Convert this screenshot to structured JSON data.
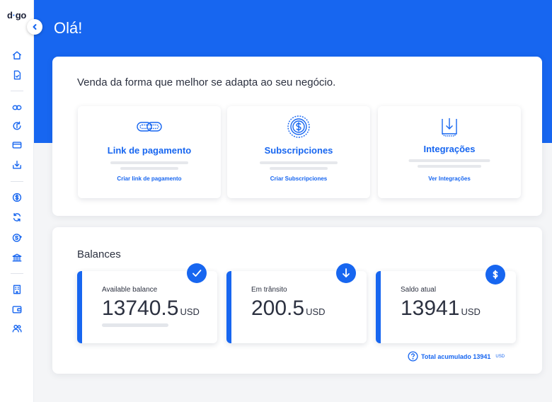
{
  "app": {
    "logo_main": "d",
    "logo_dot": "·",
    "logo_rest": "go",
    "greeting": "Olá!",
    "accent_color": "#1766f0"
  },
  "sidebar": {
    "items": [
      {
        "name": "home-icon"
      },
      {
        "name": "document-icon"
      },
      {
        "name": "link-icon"
      },
      {
        "name": "refresh-dollar-icon"
      },
      {
        "name": "card-icon"
      },
      {
        "name": "download-tray-icon"
      },
      {
        "name": "dollar-circle-icon"
      },
      {
        "name": "sync-icon"
      },
      {
        "name": "dollar-transfer-icon"
      },
      {
        "name": "bank-icon"
      },
      {
        "name": "building-icon"
      },
      {
        "name": "wallet-icon"
      },
      {
        "name": "users-icon"
      }
    ]
  },
  "sales": {
    "heading": "Venda da forma que melhor se adapta ao seu negócio.",
    "cards": [
      {
        "title": "Link de pagamento",
        "link": "Criar link de pagamento",
        "icon": "chain-link-icon"
      },
      {
        "title": "Subscripciones",
        "link": "Criar Subscripciones",
        "icon": "recurring-dollar-icon"
      },
      {
        "title": "Integrações",
        "link": "Ver Integrações",
        "icon": "download-box-icon"
      }
    ]
  },
  "balances": {
    "heading": "Balances",
    "cards": [
      {
        "label": "Available balance",
        "value": "13740.5",
        "unit": "USD",
        "icon": "check-icon"
      },
      {
        "label": "Em trânsito",
        "value": "200.5",
        "unit": "USD",
        "icon": "arrow-down-icon"
      },
      {
        "label": "Saldo atual",
        "value": "13941",
        "unit": "USD",
        "icon": "dollar-icon"
      }
    ],
    "total_text": "Total acumulado 13941",
    "total_unit": "USD"
  }
}
